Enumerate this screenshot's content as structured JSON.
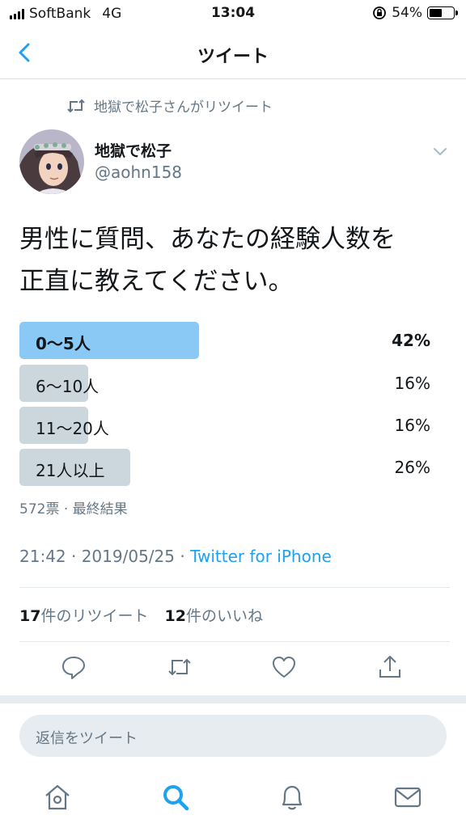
{
  "status_bar": {
    "carrier": "SoftBank",
    "network": "4G",
    "time": "13:04",
    "battery": "54%",
    "battery_level": 0.54
  },
  "nav": {
    "title": "ツイート"
  },
  "retweet": {
    "text": "地獄で松子さんがリツイート"
  },
  "author": {
    "name": "地獄で松子",
    "handle": "@aohn158"
  },
  "tweet": {
    "line1": "男性に質問、あなたの経験人数を",
    "line2": "正直に教えてください。"
  },
  "poll": {
    "options": [
      {
        "label": "0〜5人",
        "percent": "42%",
        "fraction": 0.42,
        "winner": true
      },
      {
        "label": "6〜10人",
        "percent": "16%",
        "fraction": 0.16,
        "winner": false
      },
      {
        "label": "11〜20人",
        "percent": "16%",
        "fraction": 0.16,
        "winner": false
      },
      {
        "label": "21人以上",
        "percent": "26%",
        "fraction": 0.26,
        "winner": false
      }
    ],
    "meta": "572票 · 最終結果"
  },
  "timestamp": {
    "time": "21:42 · 2019/05/25 · ",
    "source": "Twitter for iPhone"
  },
  "stats": {
    "retweet_count": "17",
    "retweet_label": "件のリツイート",
    "like_count": "12",
    "like_label": "件のいいね"
  },
  "actions": [
    "reply-icon",
    "retweet-icon",
    "like-icon",
    "share-icon"
  ],
  "reply": {
    "placeholder": "返信をツイート"
  },
  "tabs": [
    "home-icon",
    "search-icon",
    "notifications-icon",
    "messages-icon"
  ],
  "colors": {
    "accent": "#1da1f2",
    "poll_winner": "#8ac8f6",
    "poll_other": "#ccd6dd",
    "muted": "#657786"
  }
}
